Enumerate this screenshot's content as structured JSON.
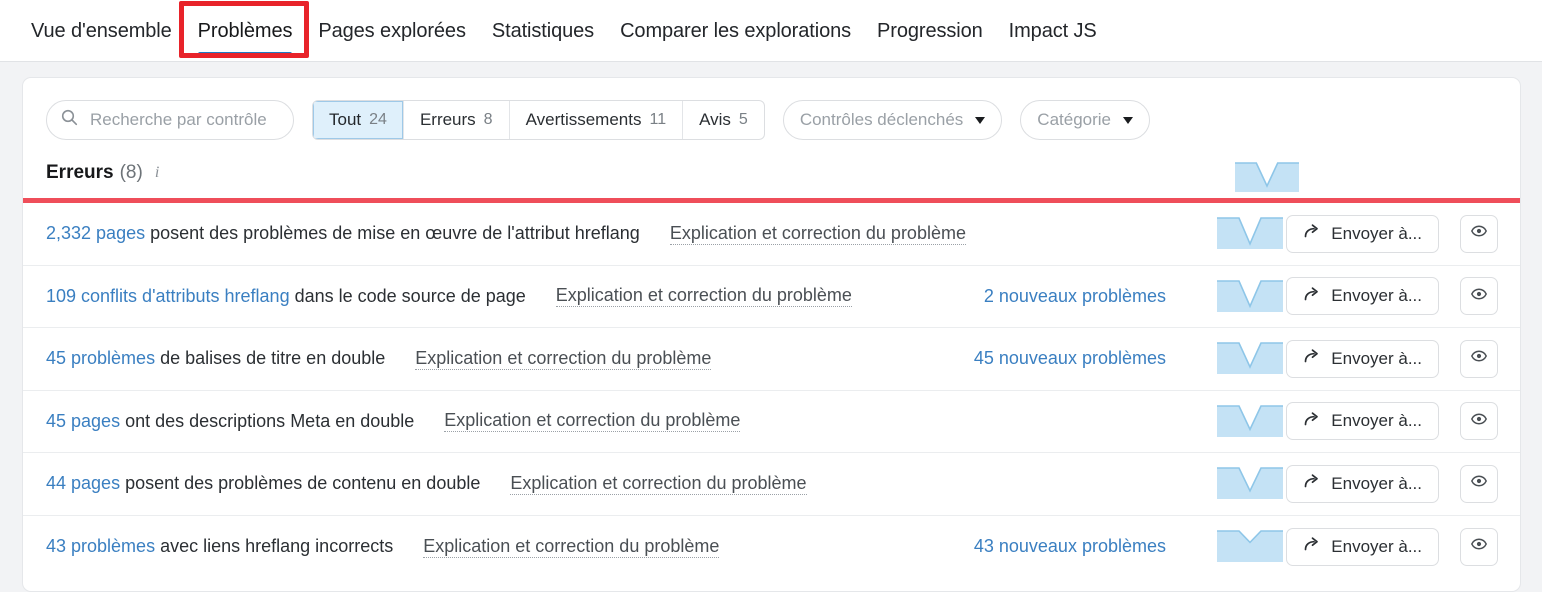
{
  "tabs": [
    {
      "label": "Vue d'ensemble",
      "active": false
    },
    {
      "label": "Problèmes",
      "active": true
    },
    {
      "label": "Pages explorées",
      "active": false
    },
    {
      "label": "Statistiques",
      "active": false
    },
    {
      "label": "Comparer les explorations",
      "active": false
    },
    {
      "label": "Progression",
      "active": false
    },
    {
      "label": "Impact JS",
      "active": false
    }
  ],
  "annotation": {
    "color": "#e8232a",
    "target": "Problèmes"
  },
  "accent": {
    "tab_underline": "#1f7ac2",
    "link": "#3a7fc1",
    "error_rule": "#ef4e5a",
    "spark_fill": "#c4e2f5"
  },
  "search": {
    "placeholder": "Recherche par contrôle",
    "value": "",
    "icon": "search-icon"
  },
  "segments": [
    {
      "label": "Tout",
      "count": "24",
      "active": true
    },
    {
      "label": "Erreurs",
      "count": "8",
      "active": false
    },
    {
      "label": "Avertissements",
      "count": "11",
      "active": false
    },
    {
      "label": "Avis",
      "count": "5",
      "active": false
    }
  ],
  "dropdowns": [
    {
      "label": "Contrôles déclenchés",
      "icon": "chevron-down-icon"
    },
    {
      "label": "Catégorie",
      "icon": "chevron-down-icon"
    }
  ],
  "section": {
    "title": "Erreurs",
    "count": "(8)",
    "info_icon": "i",
    "sparkline": {
      "values": [
        100,
        100,
        100,
        18,
        100,
        100,
        100
      ]
    }
  },
  "row_actions": {
    "send_label": "Envoyer à...",
    "send_icon": "share-arrow-icon",
    "view_icon": "eye-icon"
  },
  "rows": [
    {
      "link": "2,332 pages",
      "rest": "posent des problèmes de mise en œuvre de l'attribut hreflang",
      "explain": "Explication et correction du problème",
      "new_issues": "",
      "sparkline": {
        "values": [
          100,
          100,
          100,
          14,
          100,
          100,
          100
        ]
      }
    },
    {
      "link": "109 conflits d'attributs hreflang",
      "rest": "dans le code source de page",
      "explain": "Explication et correction du problème",
      "new_issues": "2 nouveaux problèmes",
      "sparkline": {
        "values": [
          100,
          100,
          100,
          16,
          100,
          100,
          100
        ]
      }
    },
    {
      "link": "45 problèmes",
      "rest": "de balises de titre en double",
      "explain": "Explication et correction du problème",
      "new_issues": "45 nouveaux problèmes",
      "sparkline": {
        "values": [
          100,
          100,
          100,
          20,
          100,
          100,
          100
        ]
      }
    },
    {
      "link": "45 pages",
      "rest": "ont des descriptions Meta en double",
      "explain": "Explication et correction du problème",
      "new_issues": "",
      "sparkline": {
        "values": [
          100,
          100,
          100,
          22,
          100,
          100,
          100
        ]
      }
    },
    {
      "link": "44 pages",
      "rest": "posent des problèmes de contenu en double",
      "explain": "Explication et correction du problème",
      "new_issues": "",
      "sparkline": {
        "values": [
          100,
          100,
          100,
          24,
          100,
          100,
          100
        ]
      }
    },
    {
      "link": "43 problèmes",
      "rest": "avec liens hreflang incorrects",
      "explain": "Explication et correction du problème",
      "new_issues": "43 nouveaux problèmes",
      "sparkline": {
        "values": [
          100,
          100,
          100,
          62,
          100,
          100,
          100
        ]
      }
    }
  ]
}
